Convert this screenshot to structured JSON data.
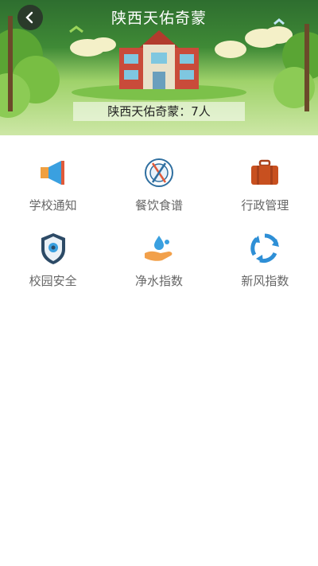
{
  "header": {
    "title": "陕西天佑奇蒙",
    "banner_text": "陕西天佑奇蒙：7人"
  },
  "menu": [
    {
      "label": "学校通知",
      "icon": "megaphone-icon",
      "color": "#3aa0e0"
    },
    {
      "label": "餐饮食谱",
      "icon": "plate-utensils-icon",
      "color": "#2f6fa0"
    },
    {
      "label": "行政管理",
      "icon": "briefcase-icon",
      "color": "#c8501f"
    },
    {
      "label": "校园安全",
      "icon": "security-camera-shield-icon",
      "color": "#2c4a66"
    },
    {
      "label": "净水指数",
      "icon": "water-drop-hand-icon",
      "color": "#f2a04a"
    },
    {
      "label": "新风指数",
      "icon": "refresh-cycle-icon",
      "color": "#2e8fd6"
    }
  ],
  "colors": {
    "accent": "#3aa0e0",
    "header_green": "#3f8a36"
  }
}
